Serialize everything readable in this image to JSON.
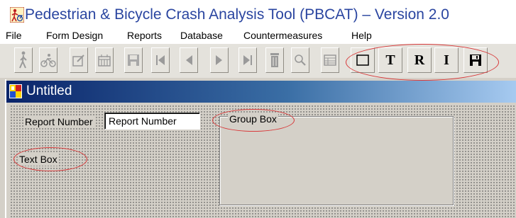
{
  "app": {
    "title": "Pedestrian & Bicycle Crash Analysis Tool (PBCAT) – Version 2.0",
    "icon": "pbcat-app-icon"
  },
  "menubar": {
    "items": [
      "File",
      "Form Design",
      "Reports",
      "Database",
      "Countermeasures",
      "Help"
    ]
  },
  "toolbar": {
    "buttons": [
      {
        "icon": "pedestrian-icon"
      },
      {
        "icon": "bicycle-icon"
      },
      {
        "icon": "edit-form-icon"
      },
      {
        "icon": "calendar-icon"
      },
      {
        "icon": "save-icon"
      },
      {
        "icon": "first-record-icon"
      },
      {
        "icon": "previous-record-icon"
      },
      {
        "icon": "next-record-icon"
      },
      {
        "icon": "last-record-icon"
      },
      {
        "icon": "delete-icon"
      },
      {
        "icon": "search-icon"
      },
      {
        "icon": "table-view-icon"
      }
    ],
    "form_design_buttons": [
      {
        "icon": "group-box-tool-icon",
        "label": ""
      },
      {
        "icon": "text-box-tool-icon",
        "label": "T"
      },
      {
        "icon": "report-number-tool-icon",
        "label": "R"
      },
      {
        "icon": "image-tool-icon",
        "label": "I"
      },
      {
        "icon": "save-form-icon",
        "label": ""
      }
    ]
  },
  "form_window": {
    "title": "Untitled",
    "icon": "form-window-icon",
    "gradient_start": "#0a246a",
    "gradient_end": "#a6caf0"
  },
  "form_canvas": {
    "report_number_label": "Report Number",
    "report_number_value": "Report Number",
    "group_box_label": "Group Box",
    "text_box_label": "Text Box"
  },
  "annotation_color": "#d8393a"
}
